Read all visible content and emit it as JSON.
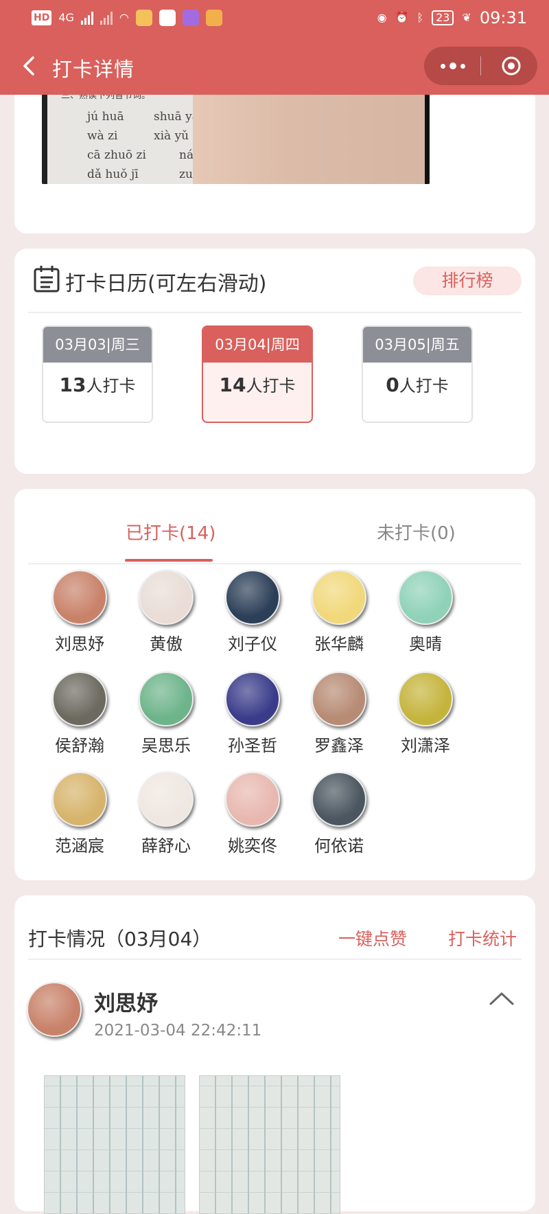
{
  "status_bar": {
    "network_left": "HD",
    "network_type": "4G",
    "battery": "23",
    "time": "09:31"
  },
  "nav": {
    "title": "打卡详情",
    "back_icon": "chevron-left-icon",
    "more_icon": "more-dots-icon",
    "close_icon": "target-circle-icon"
  },
  "top_photo": {
    "lines": [
      "三、熟读下列音节词。",
      "jú huā",
      "shuā yá",
      "wà zi",
      "xià yǔ",
      "cā zhuō zi",
      "ná p",
      "dǎ huǒ jī",
      "zuò h"
    ]
  },
  "calendar": {
    "title": "打卡日历(可左右滑动)",
    "rank_button": "排行榜",
    "days": [
      {
        "date": "03月03|周三",
        "count": "13",
        "suffix": "人打卡",
        "active": false
      },
      {
        "date": "03月04|周四",
        "count": "14",
        "suffix": "人打卡",
        "active": true
      },
      {
        "date": "03月05|周五",
        "count": "0",
        "suffix": "人打卡",
        "active": false
      }
    ]
  },
  "members": {
    "tabs": [
      {
        "label": "已打卡(14)",
        "active": true
      },
      {
        "label": "未打卡(0)",
        "active": false
      }
    ],
    "list": [
      {
        "name": "刘思妤",
        "color": "#c9826a"
      },
      {
        "name": "黄傲",
        "color": "#e9ddd6"
      },
      {
        "name": "刘子仪",
        "color": "#2c3f58"
      },
      {
        "name": "张华麟",
        "color": "#f1d87a"
      },
      {
        "name": "奥晴",
        "color": "#8fd2b8"
      },
      {
        "name": "侯舒瀚",
        "color": "#6c6a5f"
      },
      {
        "name": "吴思乐",
        "color": "#6db48a"
      },
      {
        "name": "孙圣哲",
        "color": "#3a3c8a"
      },
      {
        "name": "罗鑫泽",
        "color": "#b78b74"
      },
      {
        "name": "刘潇泽",
        "color": "#c5b43c"
      },
      {
        "name": "范涵宸",
        "color": "#d6b46b"
      },
      {
        "name": "薛舒心",
        "color": "#efe7e1"
      },
      {
        "name": "姚奕佟",
        "color": "#e8b8b0"
      },
      {
        "name": "何依诺",
        "color": "#4b5660"
      }
    ]
  },
  "records": {
    "title": "打卡情况（03月04）",
    "like_all": "一键点赞",
    "stats": "打卡统计",
    "entry": {
      "name": "刘思妤",
      "time": "2021-03-04 22:42:11",
      "avatar_color": "#c9826a"
    }
  }
}
